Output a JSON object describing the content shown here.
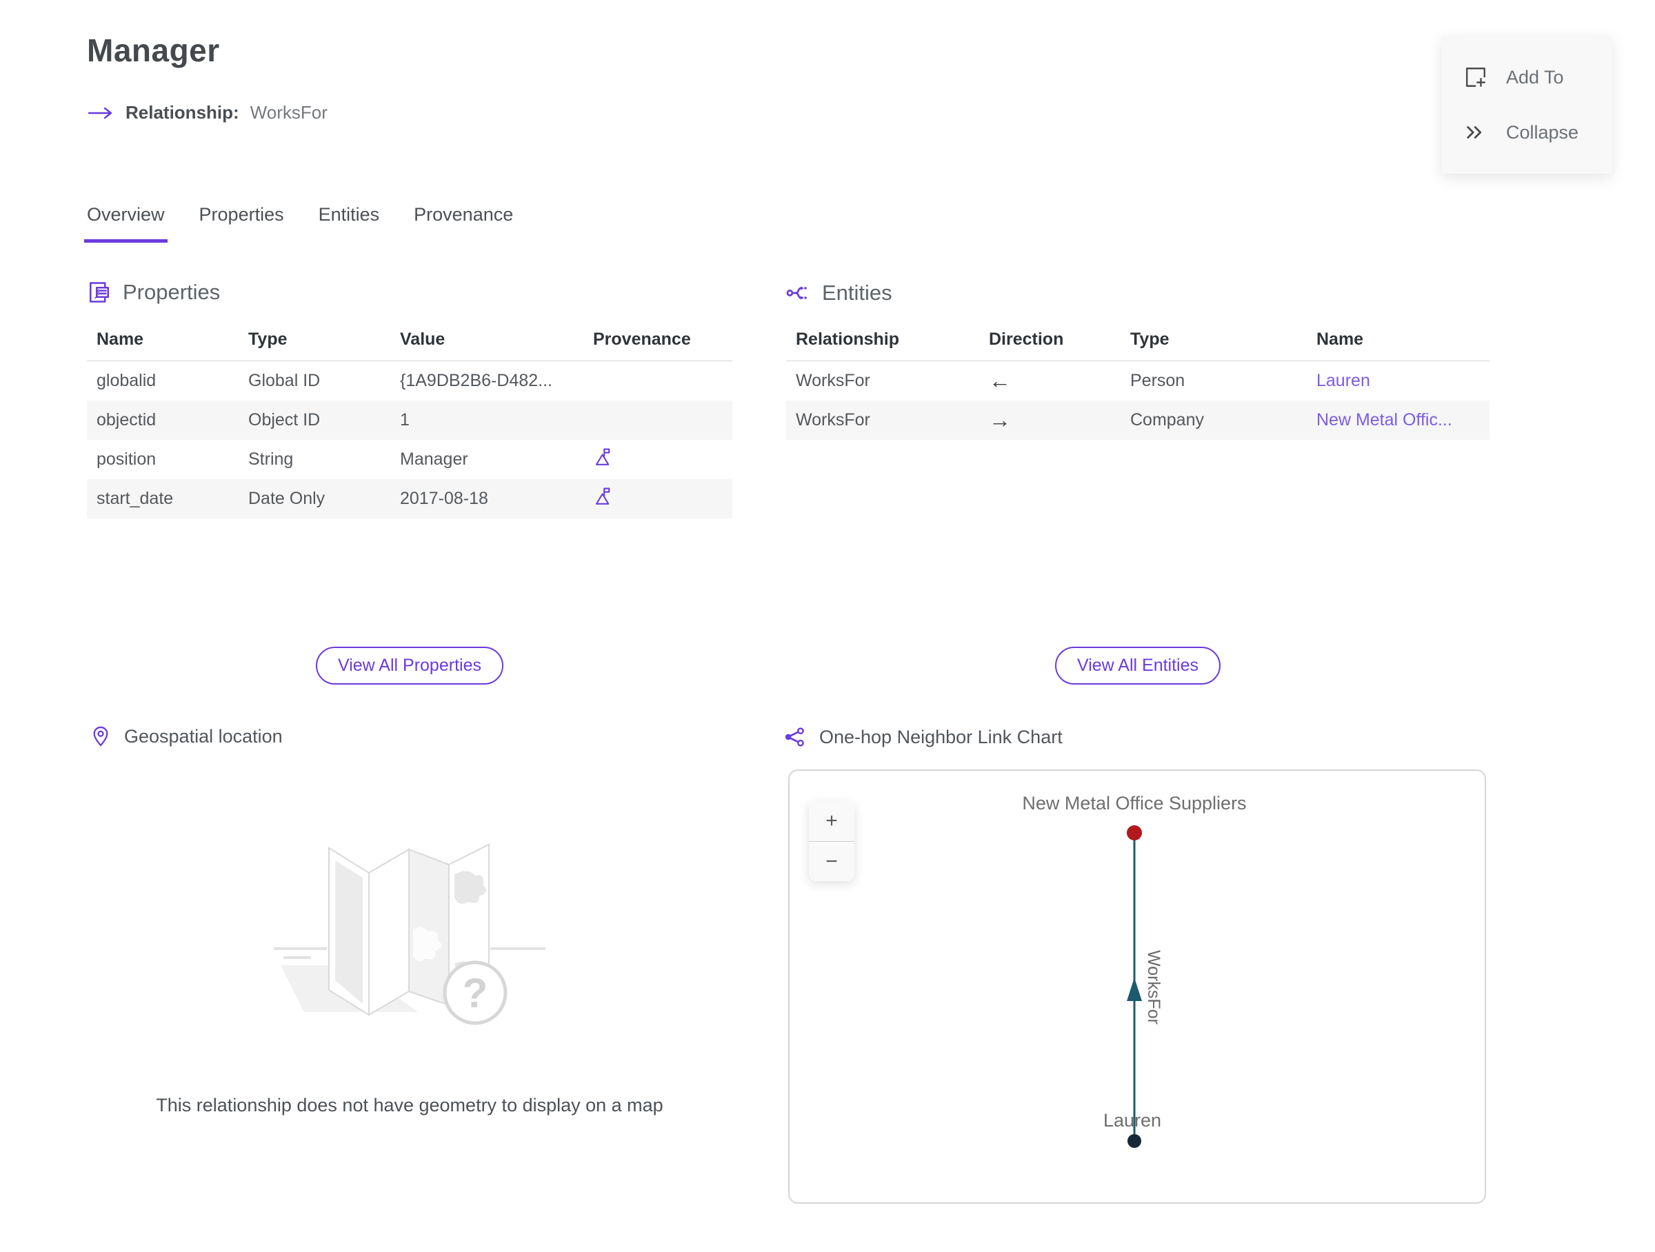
{
  "header": {
    "title": "Manager",
    "relationship_label": "Relationship:",
    "relationship_value": "WorksFor"
  },
  "actions": {
    "add_to_label": "Add To",
    "collapse_label": "Collapse"
  },
  "tabs": [
    {
      "label": "Overview",
      "active": true
    },
    {
      "label": "Properties",
      "active": false
    },
    {
      "label": "Entities",
      "active": false
    },
    {
      "label": "Provenance",
      "active": false
    }
  ],
  "properties_section": {
    "title": "Properties",
    "columns": [
      "Name",
      "Type",
      "Value",
      "Provenance"
    ],
    "rows": [
      {
        "name": "globalid",
        "type": "Global ID",
        "value": "{1A9DB2B6-D482...",
        "has_provenance": false
      },
      {
        "name": "objectid",
        "type": "Object ID",
        "value": "1",
        "has_provenance": false
      },
      {
        "name": "position",
        "type": "String",
        "value": "Manager",
        "has_provenance": true
      },
      {
        "name": "start_date",
        "type": "Date Only",
        "value": "2017-08-18",
        "has_provenance": true
      }
    ],
    "view_all_label": "View All Properties"
  },
  "entities_section": {
    "title": "Entities",
    "columns": [
      "Relationship",
      "Direction",
      "Type",
      "Name"
    ],
    "rows": [
      {
        "relationship": "WorksFor",
        "direction": "←",
        "type": "Person",
        "name": "Lauren"
      },
      {
        "relationship": "WorksFor",
        "direction": "→",
        "type": "Company",
        "name": "New Metal Offic..."
      }
    ],
    "view_all_label": "View All Entities"
  },
  "geospatial_section": {
    "title": "Geospatial location",
    "placeholder_glyph": "?",
    "empty_message": "This relationship does not have geometry to display on a map"
  },
  "link_chart_section": {
    "title": "One-hop Neighbor Link Chart",
    "zoom_in_label": "+",
    "zoom_out_label": "−",
    "chart_data": {
      "type": "node-link",
      "nodes": [
        {
          "id": "company",
          "label": "New Metal Office Suppliers",
          "entity_type": "Company",
          "color": "#b2191d",
          "position": "top"
        },
        {
          "id": "person",
          "label": "Lauren",
          "entity_type": "Person",
          "color": "#152838",
          "position": "bottom"
        }
      ],
      "edges": [
        {
          "source": "person",
          "target": "company",
          "label": "WorksFor",
          "direction": "up",
          "color": "#1d5a6e"
        }
      ]
    }
  },
  "colors": {
    "accent": "#6a3bdc",
    "link": "#7c5ce4",
    "edge": "#1d5a6e",
    "node-red": "#b2191d",
    "node-navy": "#152838"
  }
}
